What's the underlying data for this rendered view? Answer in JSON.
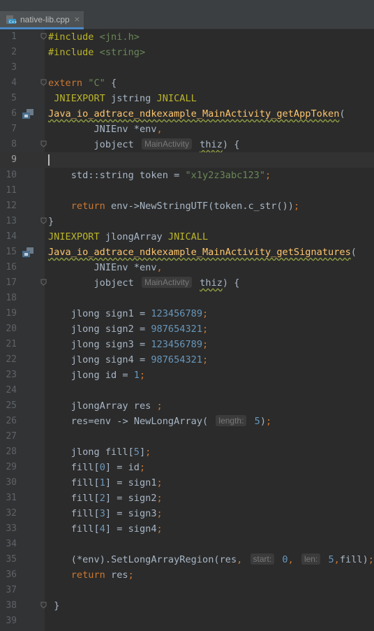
{
  "tab": {
    "file_name": "native-lib.cpp",
    "close_glyph": "×",
    "icon": "cpp-file-icon"
  },
  "editor": {
    "current_line": 9,
    "lines": [
      {
        "no": "1",
        "t": "#include <jni.h>"
      },
      {
        "no": "2",
        "t": "#include <string>"
      },
      {
        "no": "3",
        "t": ""
      },
      {
        "no": "4",
        "t": "extern \"C\" {"
      },
      {
        "no": "5",
        "t": " JNIEXPORT jstring JNICALL"
      },
      {
        "no": "6",
        "t": "Java_io_adtrace_ndkexample_MainActivity_getAppToken("
      },
      {
        "no": "7",
        "t": "        JNIEnv *env,"
      },
      {
        "no": "8",
        "t": "        jobject MainActivity thiz) {"
      },
      {
        "no": "9",
        "t": ""
      },
      {
        "no": "10",
        "t": "    std::string token = \"x1y2z3abc123\";"
      },
      {
        "no": "11",
        "t": ""
      },
      {
        "no": "12",
        "t": "    return env->NewStringUTF(token.c_str());"
      },
      {
        "no": "13",
        "t": "}"
      },
      {
        "no": "14",
        "t": "JNIEXPORT jlongArray JNICALL"
      },
      {
        "no": "15",
        "t": "Java_io_adtrace_ndkexample_MainActivity_getSignatures("
      },
      {
        "no": "16",
        "t": "        JNIEnv *env,"
      },
      {
        "no": "17",
        "t": "        jobject MainActivity thiz) {"
      },
      {
        "no": "18",
        "t": ""
      },
      {
        "no": "19",
        "t": "    jlong sign1 = 123456789;"
      },
      {
        "no": "20",
        "t": "    jlong sign2 = 987654321;"
      },
      {
        "no": "21",
        "t": "    jlong sign3 = 123456789;"
      },
      {
        "no": "22",
        "t": "    jlong sign4 = 987654321;"
      },
      {
        "no": "23",
        "t": "    jlong id = 1;"
      },
      {
        "no": "24",
        "t": ""
      },
      {
        "no": "25",
        "t": "    jlongArray res ;"
      },
      {
        "no": "26",
        "t": "    res=env -> NewLongArray( length: 5);"
      },
      {
        "no": "27",
        "t": ""
      },
      {
        "no": "28",
        "t": "    jlong fill[5];"
      },
      {
        "no": "29",
        "t": "    fill[0] = id;"
      },
      {
        "no": "30",
        "t": "    fill[1] = sign1;"
      },
      {
        "no": "31",
        "t": "    fill[2] = sign2;"
      },
      {
        "no": "32",
        "t": "    fill[3] = sign3;"
      },
      {
        "no": "33",
        "t": "    fill[4] = sign4;"
      },
      {
        "no": "34",
        "t": ""
      },
      {
        "no": "35",
        "t": "    (*env).SetLongArrayRegion(res, start: 0, len: 5,fill);"
      },
      {
        "no": "36",
        "t": "    return res;"
      },
      {
        "no": "37",
        "t": ""
      },
      {
        "no": "38",
        "t": " }"
      },
      {
        "no": "39",
        "t": ""
      }
    ],
    "gutter_icons": {
      "6": "jni-method-icon",
      "15": "jni-method-icon"
    },
    "fold_markers": [
      "1",
      "4",
      "8",
      "13",
      "17",
      "38"
    ]
  },
  "colors": {
    "background": "#2b2b2b",
    "gutter": "#313335",
    "keyword": "#cc7832",
    "preprocessor": "#bbb529",
    "string": "#6a8759",
    "number": "#6897bb",
    "function": "#ffc66d",
    "identifier": "#a9b7c6",
    "line_number": "#606366",
    "tab_accent": "#4a88c7"
  }
}
